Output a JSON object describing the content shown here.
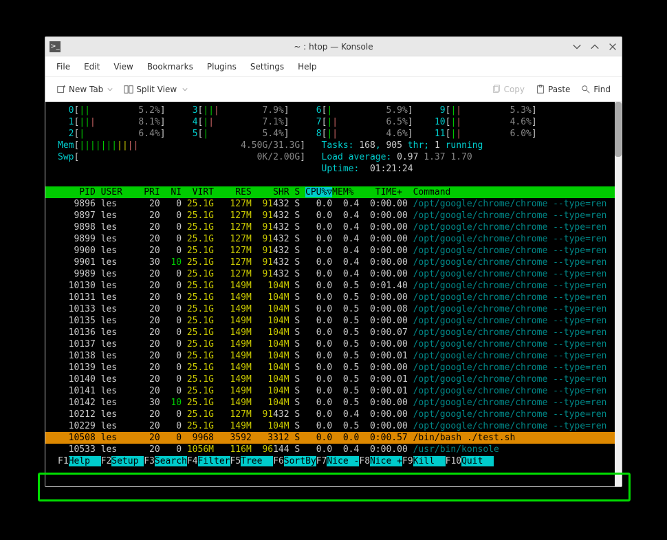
{
  "window": {
    "title": "~ : htop — Konsole"
  },
  "menu": [
    "File",
    "Edit",
    "View",
    "Bookmarks",
    "Plugins",
    "Settings",
    "Help"
  ],
  "toolbar": {
    "new_tab": "New Tab",
    "split_view": "Split View",
    "copy": "Copy",
    "paste": "Paste",
    "find": "Find"
  },
  "cpus": [
    {
      "id": "0",
      "bars": "||",
      "pct": "5.2%",
      "col": "green"
    },
    {
      "id": "1",
      "bars": "|||",
      "pct": "8.1%",
      "col": "mix"
    },
    {
      "id": "2",
      "bars": "|",
      "pct": "6.4%",
      "col": "green"
    },
    {
      "id": "3",
      "bars": "|||",
      "pct": "7.9%",
      "col": "mix"
    },
    {
      "id": "4",
      "bars": "||",
      "pct": "7.1%",
      "col": "mix"
    },
    {
      "id": "5",
      "bars": "|",
      "pct": "5.4%",
      "col": "green"
    },
    {
      "id": "6",
      "bars": "|",
      "pct": "5.9%",
      "col": "green"
    },
    {
      "id": "7",
      "bars": "||",
      "pct": "6.5%",
      "col": "mix"
    },
    {
      "id": "8",
      "bars": "||",
      "pct": "4.6%",
      "col": "mix"
    },
    {
      "id": "9",
      "bars": "||",
      "pct": "5.3%",
      "col": "mix"
    },
    {
      "id": "10",
      "bars": "||",
      "pct": "4.6%",
      "col": "mix"
    },
    {
      "id": "11",
      "bars": "||",
      "pct": "6.0%",
      "col": "mix"
    }
  ],
  "mem": {
    "label": "Mem",
    "bars": "|||||||||||",
    "val": "4.50G/31.3G"
  },
  "swp": {
    "label": "Swp",
    "bars": "",
    "val": "0K/2.00G"
  },
  "tasks": {
    "label": "Tasks:",
    "count": "168",
    "sep": ",",
    "thr": "905",
    "thr_label": "thr;",
    "run": "1",
    "run_label": "running"
  },
  "load": {
    "label": "Load average:",
    "a": "0.97",
    "b": "1.37",
    "c": "1.70"
  },
  "uptime": {
    "label": "Uptime:",
    "val": "01:21:24"
  },
  "header": {
    "pid": "PID",
    "user": "USER",
    "pri": "PRI",
    "ni": "NI",
    "virt": "VIRT",
    "res": "RES",
    "shr": "SHR",
    "s": "S",
    "cpu": "CPU%▽",
    "mem": "MEM%",
    "time": "TIME+",
    "cmd": "Command"
  },
  "processes": [
    {
      "pid": "9896",
      "user": "les",
      "pri": "20",
      "ni": "0",
      "virt": "25.1G",
      "res": "127M",
      "shr": "91432",
      "s": "S",
      "cpu": "0.0",
      "mem": "0.4",
      "time": "0:00.00",
      "cmd": "/opt/google/chrome/chrome --type=ren",
      "hi": false,
      "shr_split": true
    },
    {
      "pid": "9897",
      "user": "les",
      "pri": "20",
      "ni": "0",
      "virt": "25.1G",
      "res": "127M",
      "shr": "91432",
      "s": "S",
      "cpu": "0.0",
      "mem": "0.4",
      "time": "0:00.00",
      "cmd": "/opt/google/chrome/chrome --type=ren",
      "hi": false,
      "shr_split": true
    },
    {
      "pid": "9898",
      "user": "les",
      "pri": "20",
      "ni": "0",
      "virt": "25.1G",
      "res": "127M",
      "shr": "91432",
      "s": "S",
      "cpu": "0.0",
      "mem": "0.4",
      "time": "0:00.00",
      "cmd": "/opt/google/chrome/chrome --type=ren",
      "hi": false,
      "shr_split": true
    },
    {
      "pid": "9899",
      "user": "les",
      "pri": "20",
      "ni": "0",
      "virt": "25.1G",
      "res": "127M",
      "shr": "91432",
      "s": "S",
      "cpu": "0.0",
      "mem": "0.4",
      "time": "0:00.00",
      "cmd": "/opt/google/chrome/chrome --type=ren",
      "hi": false,
      "shr_split": true
    },
    {
      "pid": "9900",
      "user": "les",
      "pri": "20",
      "ni": "0",
      "virt": "25.1G",
      "res": "127M",
      "shr": "91432",
      "s": "S",
      "cpu": "0.0",
      "mem": "0.4",
      "time": "0:00.00",
      "cmd": "/opt/google/chrome/chrome --type=ren",
      "hi": false,
      "shr_split": true
    },
    {
      "pid": "9901",
      "user": "les",
      "pri": "30",
      "ni": "10",
      "virt": "25.1G",
      "res": "127M",
      "shr": "91432",
      "s": "S",
      "cpu": "0.0",
      "mem": "0.4",
      "time": "0:00.00",
      "cmd": "/opt/google/chrome/chrome --type=ren",
      "hi": true,
      "shr_split": true
    },
    {
      "pid": "9989",
      "user": "les",
      "pri": "20",
      "ni": "0",
      "virt": "25.1G",
      "res": "127M",
      "shr": "91432",
      "s": "S",
      "cpu": "0.0",
      "mem": "0.4",
      "time": "0:00.00",
      "cmd": "/opt/google/chrome/chrome --type=ren",
      "hi": false,
      "shr_split": true
    },
    {
      "pid": "10130",
      "user": "les",
      "pri": "20",
      "ni": "0",
      "virt": "25.1G",
      "res": "149M",
      "shr": "104M",
      "s": "S",
      "cpu": "0.0",
      "mem": "0.5",
      "time": "0:01.40",
      "cmd": "/opt/google/chrome/chrome --type=ren",
      "hi": false,
      "shr_split": false
    },
    {
      "pid": "10131",
      "user": "les",
      "pri": "20",
      "ni": "0",
      "virt": "25.1G",
      "res": "149M",
      "shr": "104M",
      "s": "S",
      "cpu": "0.0",
      "mem": "0.5",
      "time": "0:00.00",
      "cmd": "/opt/google/chrome/chrome --type=ren",
      "hi": false,
      "shr_split": false
    },
    {
      "pid": "10133",
      "user": "les",
      "pri": "20",
      "ni": "0",
      "virt": "25.1G",
      "res": "149M",
      "shr": "104M",
      "s": "S",
      "cpu": "0.0",
      "mem": "0.5",
      "time": "0:00.08",
      "cmd": "/opt/google/chrome/chrome --type=ren",
      "hi": false,
      "shr_split": false
    },
    {
      "pid": "10135",
      "user": "les",
      "pri": "20",
      "ni": "0",
      "virt": "25.1G",
      "res": "149M",
      "shr": "104M",
      "s": "S",
      "cpu": "0.0",
      "mem": "0.5",
      "time": "0:00.00",
      "cmd": "/opt/google/chrome/chrome --type=ren",
      "hi": false,
      "shr_split": false
    },
    {
      "pid": "10136",
      "user": "les",
      "pri": "20",
      "ni": "0",
      "virt": "25.1G",
      "res": "149M",
      "shr": "104M",
      "s": "S",
      "cpu": "0.0",
      "mem": "0.5",
      "time": "0:00.07",
      "cmd": "/opt/google/chrome/chrome --type=ren",
      "hi": false,
      "shr_split": false
    },
    {
      "pid": "10137",
      "user": "les",
      "pri": "20",
      "ni": "0",
      "virt": "25.1G",
      "res": "149M",
      "shr": "104M",
      "s": "S",
      "cpu": "0.0",
      "mem": "0.5",
      "time": "0:00.00",
      "cmd": "/opt/google/chrome/chrome --type=ren",
      "hi": false,
      "shr_split": false
    },
    {
      "pid": "10138",
      "user": "les",
      "pri": "20",
      "ni": "0",
      "virt": "25.1G",
      "res": "149M",
      "shr": "104M",
      "s": "S",
      "cpu": "0.0",
      "mem": "0.5",
      "time": "0:00.01",
      "cmd": "/opt/google/chrome/chrome --type=ren",
      "hi": false,
      "shr_split": false
    },
    {
      "pid": "10139",
      "user": "les",
      "pri": "20",
      "ni": "0",
      "virt": "25.1G",
      "res": "149M",
      "shr": "104M",
      "s": "S",
      "cpu": "0.0",
      "mem": "0.5",
      "time": "0:00.00",
      "cmd": "/opt/google/chrome/chrome --type=ren",
      "hi": false,
      "shr_split": false
    },
    {
      "pid": "10140",
      "user": "les",
      "pri": "20",
      "ni": "0",
      "virt": "25.1G",
      "res": "149M",
      "shr": "104M",
      "s": "S",
      "cpu": "0.0",
      "mem": "0.5",
      "time": "0:00.01",
      "cmd": "/opt/google/chrome/chrome --type=ren",
      "hi": false,
      "shr_split": false
    },
    {
      "pid": "10141",
      "user": "les",
      "pri": "20",
      "ni": "0",
      "virt": "25.1G",
      "res": "149M",
      "shr": "104M",
      "s": "S",
      "cpu": "0.0",
      "mem": "0.5",
      "time": "0:00.01",
      "cmd": "/opt/google/chrome/chrome --type=ren",
      "hi": false,
      "shr_split": false
    },
    {
      "pid": "10142",
      "user": "les",
      "pri": "30",
      "ni": "10",
      "virt": "25.1G",
      "res": "149M",
      "shr": "104M",
      "s": "S",
      "cpu": "0.0",
      "mem": "0.5",
      "time": "0:00.00",
      "cmd": "/opt/google/chrome/chrome --type=ren",
      "hi": true,
      "shr_split": false
    },
    {
      "pid": "10212",
      "user": "les",
      "pri": "20",
      "ni": "0",
      "virt": "25.1G",
      "res": "127M",
      "shr": "91432",
      "s": "S",
      "cpu": "0.0",
      "mem": "0.4",
      "time": "0:00.00",
      "cmd": "/opt/google/chrome/chrome --type=ren",
      "hi": false,
      "shr_split": true
    },
    {
      "pid": "10229",
      "user": "les",
      "pri": "20",
      "ni": "0",
      "virt": "25.1G",
      "res": "149M",
      "shr": "104M",
      "s": "S",
      "cpu": "0.0",
      "mem": "0.5",
      "time": "0:00.00",
      "cmd": "/opt/google/chrome/chrome --type=ren",
      "hi": false,
      "shr_split": false
    },
    {
      "pid": "10508",
      "user": "les",
      "pri": "20",
      "ni": "0",
      "virt": "9968",
      "res": "3592",
      "shr": "3312",
      "s": "S",
      "cpu": "0.0",
      "mem": "0.0",
      "time": "0:00.57",
      "cmd": "/bin/bash ./test.sh",
      "selected": true
    },
    {
      "pid": "10533",
      "user": "les",
      "pri": "20",
      "ni": "0",
      "virt": "1056M",
      "res": "116M",
      "shr": "96144",
      "s": "S",
      "cpu": "0.0",
      "mem": "0.4",
      "time": "0:00.00",
      "cmd": "/usr/bin/konsole",
      "hi": false,
      "shr_split": true
    }
  ],
  "fkeys": [
    {
      "k": "F1",
      "l": "Help"
    },
    {
      "k": "F2",
      "l": "Setup"
    },
    {
      "k": "F3",
      "l": "Search"
    },
    {
      "k": "F4",
      "l": "Filter"
    },
    {
      "k": "F5",
      "l": "Tree"
    },
    {
      "k": "F6",
      "l": "SortBy"
    },
    {
      "k": "F7",
      "l": "Nice -"
    },
    {
      "k": "F8",
      "l": "Nice +"
    },
    {
      "k": "F9",
      "l": "Kill"
    },
    {
      "k": "F10",
      "l": "Quit"
    }
  ]
}
